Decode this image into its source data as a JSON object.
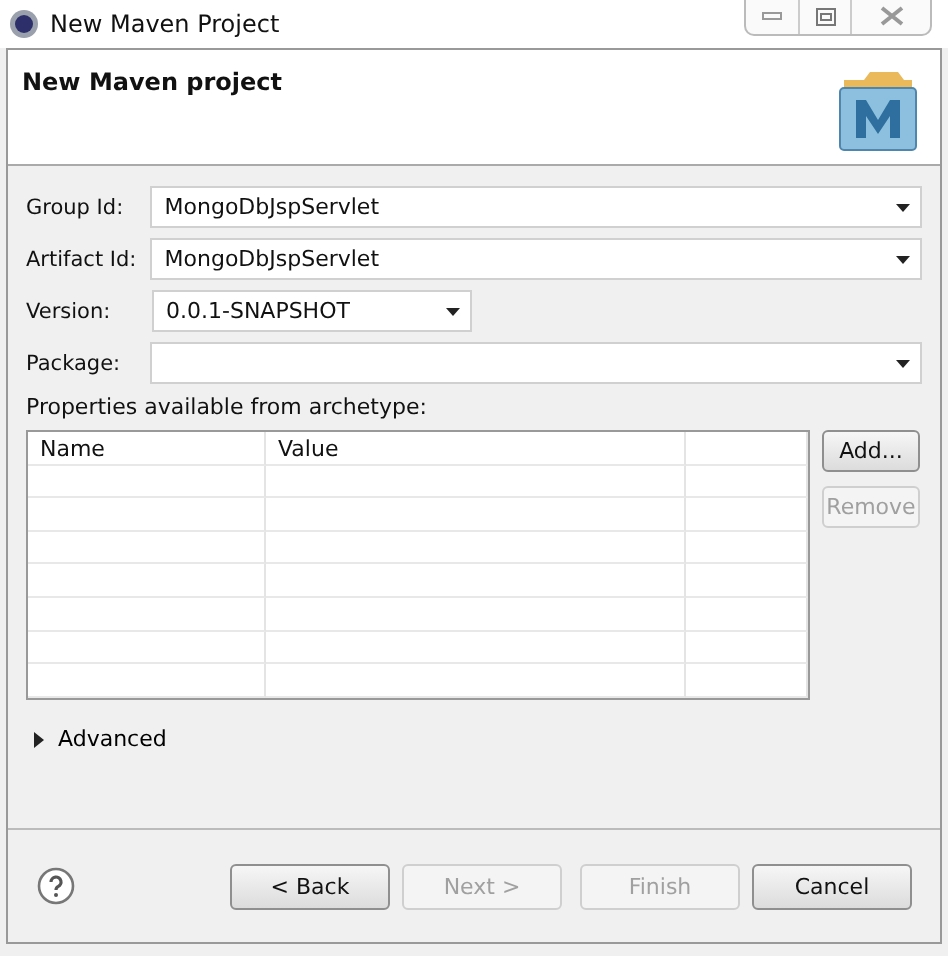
{
  "window": {
    "title": "New Maven Project"
  },
  "header": {
    "title": "New Maven project"
  },
  "fields": [
    {
      "label": "Group Id:",
      "value": "MongoDbJspServlet",
      "kind": "wide"
    },
    {
      "label": "Artifact Id:",
      "value": "MongoDbJspServlet",
      "kind": "wide"
    },
    {
      "label": "Version:",
      "value": "0.0.1-SNAPSHOT",
      "kind": "narrow"
    },
    {
      "label": "Package:",
      "kind": "wide"
    }
  ],
  "properties": {
    "label": "Properties available from archetype:",
    "columns": [
      "Name",
      "Value"
    ],
    "buttons": [
      {
        "label": "Add...",
        "disabled": false
      },
      {
        "label": "Remove",
        "disabled": true
      }
    ]
  },
  "advanced": {
    "label": "Advanced",
    "expanded": false
  },
  "buttons": [
    {
      "label": "< Back",
      "disabled": false
    },
    {
      "label": "Next >",
      "disabled": true
    },
    {
      "label": "Finish",
      "disabled": true
    },
    {
      "label": "Cancel",
      "disabled": false
    }
  ]
}
